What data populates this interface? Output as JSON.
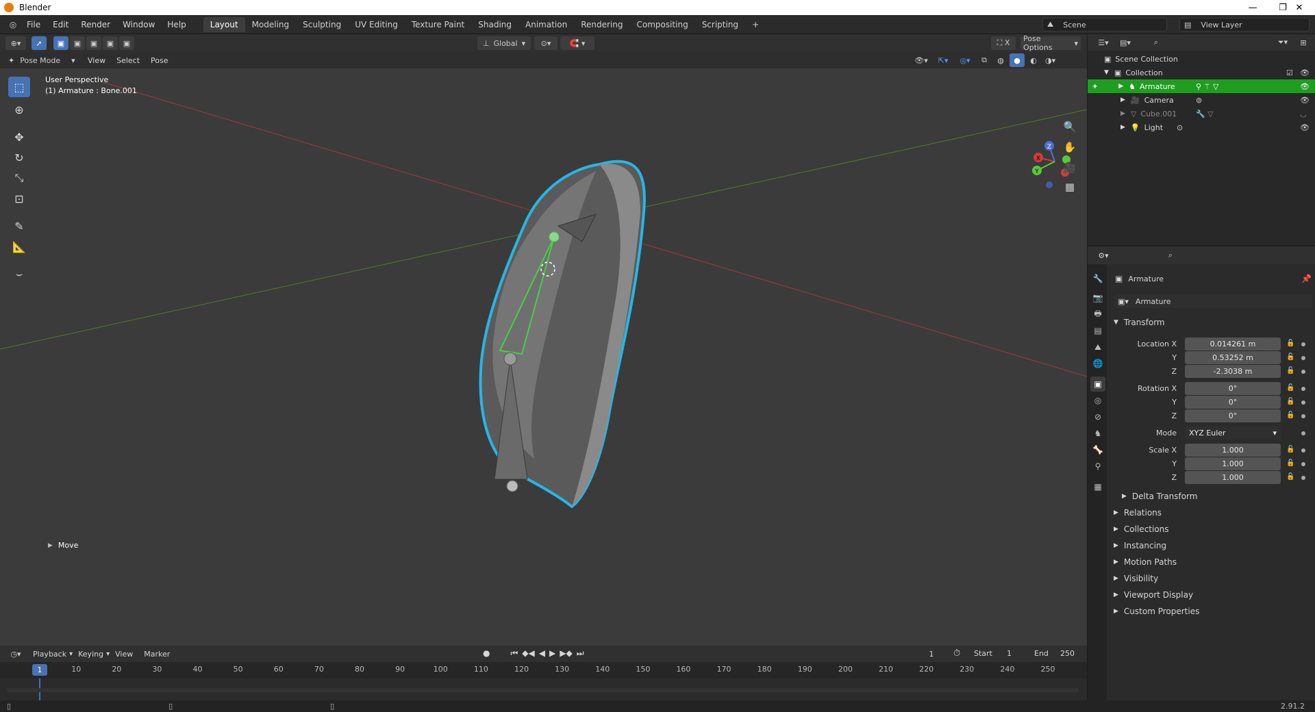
{
  "window": {
    "title": "Blender",
    "minimize": "—",
    "maximize": "❐",
    "close": "✕"
  },
  "menu": {
    "items": [
      "File",
      "Edit",
      "Render",
      "Window",
      "Help"
    ]
  },
  "workspaces": [
    "Layout",
    "Modeling",
    "Sculpting",
    "UV Editing",
    "Texture Paint",
    "Shading",
    "Animation",
    "Rendering",
    "Compositing",
    "Scripting"
  ],
  "workspace_add": "+",
  "scene": {
    "scene_name": "Scene",
    "view_layer": "View Layer"
  },
  "viewport": {
    "orientation": "Global",
    "pose_options": "Pose Options",
    "mode": "Pose Mode",
    "menus": [
      "View",
      "Select",
      "Pose"
    ],
    "perspective": "User Perspective",
    "active_info": "(1) Armature : Bone.001",
    "last_op": "Move",
    "gizmo": {
      "x": "X",
      "y": "Y",
      "z": "Z"
    }
  },
  "timeline": {
    "menus": [
      "Playback",
      "Keying",
      "View",
      "Marker"
    ],
    "current_frame": "1",
    "start_label": "Start",
    "start": "1",
    "end_label": "End",
    "end": "250",
    "ruler_current": "1",
    "ticks": [
      "10",
      "20",
      "30",
      "40",
      "50",
      "60",
      "70",
      "80",
      "90",
      "100",
      "110",
      "120",
      "130",
      "140",
      "150",
      "160",
      "170",
      "180",
      "190",
      "200",
      "210",
      "220",
      "230",
      "240",
      "250"
    ]
  },
  "outliner": {
    "scene_collection": "Scene Collection",
    "collection": "Collection",
    "items": [
      {
        "name": "Armature",
        "selected": true
      },
      {
        "name": "Camera",
        "selected": false
      },
      {
        "name": "Cube.001",
        "selected": false
      },
      {
        "name": "Light",
        "selected": false
      }
    ]
  },
  "properties": {
    "object_name": "Armature",
    "object_data_name": "Armature",
    "transform_header": "Transform",
    "location_label_x": "Location X",
    "label_y": "Y",
    "label_z": "Z",
    "location": [
      "0.014261 m",
      "0.53252 m",
      "-2.3038 m"
    ],
    "rotation_label_x": "Rotation X",
    "rotation": [
      "0°",
      "0°",
      "0°"
    ],
    "mode_label": "Mode",
    "mode_value": "XYZ Euler",
    "scale_label_x": "Scale X",
    "scale": [
      "1.000",
      "1.000",
      "1.000"
    ],
    "delta_transform": "Delta Transform",
    "panels": [
      "Relations",
      "Collections",
      "Instancing",
      "Motion Paths",
      "Visibility",
      "Viewport Display",
      "Custom Properties"
    ]
  },
  "status": {
    "version": "2.91.2"
  },
  "colors": {
    "accent": "#4772b3",
    "selection_green": "#1e9e1e",
    "outline_cyan": "#26b6e6"
  }
}
